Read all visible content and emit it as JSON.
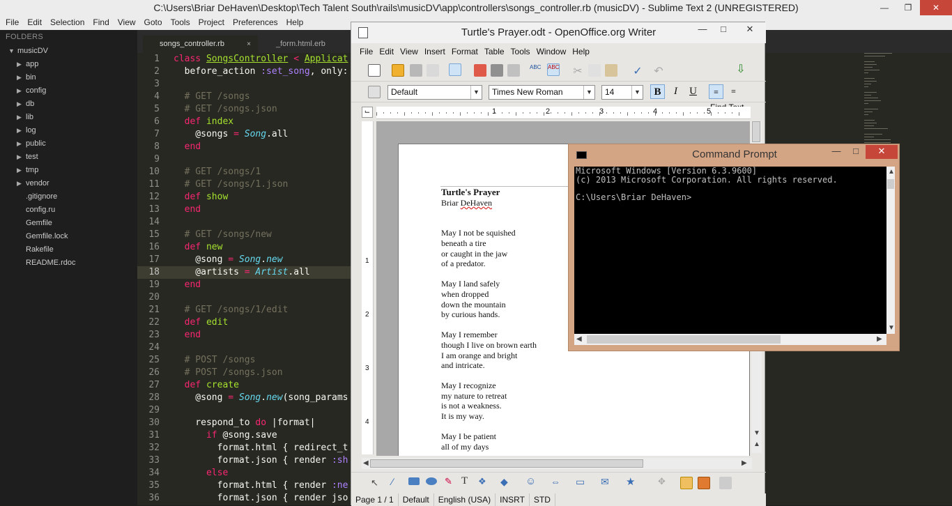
{
  "sublime": {
    "title": "C:\\Users\\Briar DeHaven\\Desktop\\Tech Talent South\\rails\\musicDV\\app\\controllers\\songs_controller.rb (musicDV) - Sublime Text 2 (UNREGISTERED)",
    "menu": [
      "File",
      "Edit",
      "Selection",
      "Find",
      "View",
      "Goto",
      "Tools",
      "Project",
      "Preferences",
      "Help"
    ],
    "sidebar": {
      "header": "FOLDERS",
      "root": "musicDV",
      "folders": [
        "app",
        "bin",
        "config",
        "db",
        "lib",
        "log",
        "public",
        "test",
        "tmp",
        "vendor"
      ],
      "files": [
        ".gitignore",
        "config.ru",
        "Gemfile",
        "Gemfile.lock",
        "Rakefile",
        "README.rdoc"
      ]
    },
    "tabs": [
      {
        "label": "songs_controller.rb",
        "close": "×",
        "active": true
      },
      {
        "label": "_form.html.erb",
        "close": "×",
        "active": false
      }
    ],
    "current_line": 18,
    "code_lines": [
      "class SongsController < Applicat",
      "  before_action :set_song, only:",
      "",
      "  # GET /songs",
      "  # GET /songs.json",
      "  def index",
      "    @songs = Song.all",
      "  end",
      "",
      "  # GET /songs/1",
      "  # GET /songs/1.json",
      "  def show",
      "  end",
      "",
      "  # GET /songs/new",
      "  def new",
      "    @song = Song.new",
      "    @artists = Artist.all",
      "  end",
      "",
      "  # GET /songs/1/edit",
      "  def edit",
      "  end",
      "",
      "  # POST /songs",
      "  # POST /songs.json",
      "  def create",
      "    @song = Song.new(song_params",
      "",
      "    respond_to do |format|",
      "      if @song.save",
      "        format.html { redirect_t",
      "        format.json { render :sh",
      "      else",
      "        format.html { render :ne",
      "        format.json { render jso"
    ]
  },
  "writer": {
    "title": "Turtle's Prayer.odt - OpenOffice.org Writer",
    "menu": [
      "File",
      "Edit",
      "View",
      "Insert",
      "Format",
      "Table",
      "Tools",
      "Window",
      "Help"
    ],
    "find_text": "Find Text",
    "style": "Default",
    "font": "Times New Roman",
    "size": "14",
    "ruler_numbers": [
      "1",
      "2",
      "3",
      "4",
      "5"
    ],
    "vruler_numbers": [
      "1",
      "2",
      "3",
      "4"
    ],
    "poem": {
      "title": "Turtle's Prayer",
      "author_first": "Briar ",
      "author_last": "DeHaven",
      "stanzas": [
        [
          "May I not be squished",
          "beneath a tire",
          "or caught in the jaw",
          "of a predator."
        ],
        [
          "May I land safely",
          "when dropped",
          "down the mountain",
          "by curious hands."
        ],
        [
          "May I remember",
          "though I live on brown earth",
          "I am orange and bright",
          "and intricate."
        ],
        [
          "May I recognize",
          "my nature to retreat",
          "is not a weakness.",
          "It is my way."
        ],
        [
          "May I be patient",
          "all of my days"
        ]
      ]
    },
    "status": [
      "Page 1 / 1",
      "Default",
      "English (USA)",
      "INSRT",
      "STD"
    ]
  },
  "cmd": {
    "title": "Command Prompt",
    "lines": [
      "Microsoft Windows [Version 6.3.9600]",
      "(c) 2013 Microsoft Corporation. All rights reserved.",
      "",
      "C:\\Users\\Briar DeHaven>"
    ]
  },
  "colors": {
    "sublime_bg": "#272822",
    "keyword": "#f92672",
    "comment": "#75715e",
    "class_name": "#a6e22e",
    "symbol": "#ae81ff",
    "const_italic": "#66d9ef",
    "cmd_border": "#d4a584",
    "close_red": "#c7463a"
  }
}
